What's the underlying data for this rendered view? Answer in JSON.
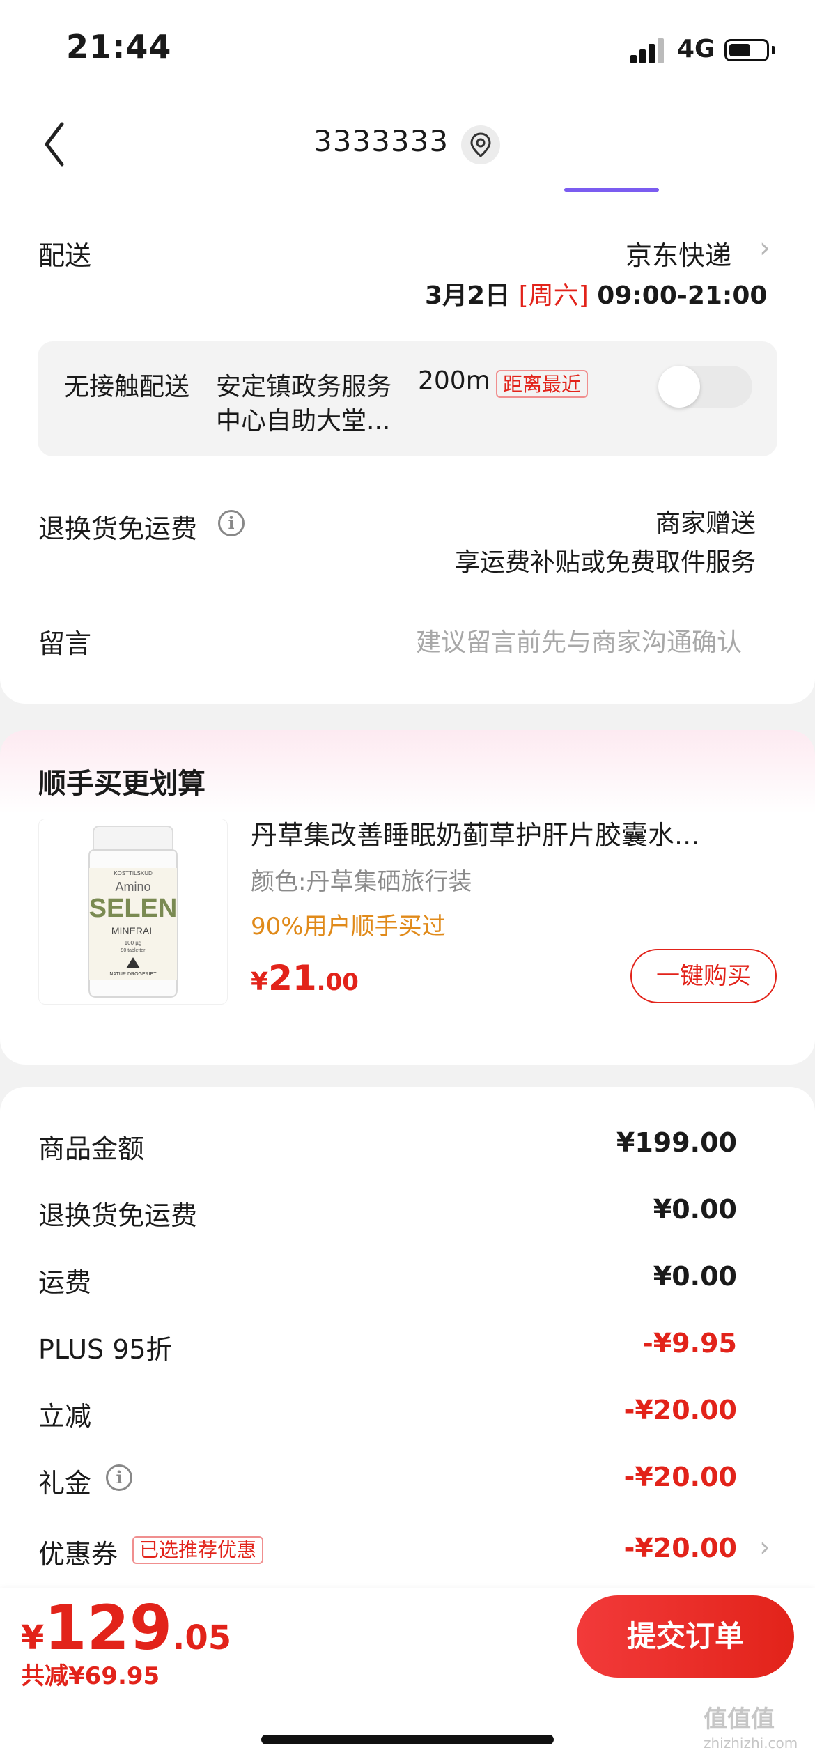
{
  "status_bar": {
    "time": "21:44",
    "network": "4G"
  },
  "header": {
    "title": "3333333"
  },
  "delivery": {
    "label": "配送",
    "carrier": "京东快递",
    "date": "3月2日",
    "weekday": "[周六]",
    "time_range": "09:00-21:00",
    "contactless_label": "无接触配送",
    "pickup_point_line1": "安定镇政务服务",
    "pickup_point_line2": "中心自助大堂...",
    "distance": "200m",
    "distance_badge": "距离最近"
  },
  "return_shipping": {
    "label": "退换货免运费",
    "value_line1": "商家赠送",
    "value_line2": "享运费补贴或免费取件服务"
  },
  "message": {
    "label": "留言",
    "placeholder": "建议留言前先与商家沟通确认"
  },
  "recommendation": {
    "title": "顺手买更划算",
    "product": {
      "name": "丹草集改善睡眠奶蓟草护肝片胶囊水...",
      "variant": "颜色:丹草集硒旅行装",
      "social_proof": "90%用户顺手买过",
      "price_symbol": "¥",
      "price_int": "21",
      "price_dec": ".00",
      "buy_label": "一键购买",
      "image_text": {
        "top": "KOSTTILSKUD",
        "brand_small": "Amino",
        "brand": "SELEN",
        "type": "MINERAL",
        "dose": "100 µg",
        "count": "90 tabletter",
        "maker": "NATUR DROGERIET"
      }
    }
  },
  "summary": {
    "rows": [
      {
        "label": "商品金额",
        "value": "¥199.00"
      },
      {
        "label": "退换货免运费",
        "value": "¥0.00"
      },
      {
        "label": "运费",
        "value": "¥0.00"
      },
      {
        "label": "PLUS 95折",
        "value": "-¥9.95"
      },
      {
        "label": "立减",
        "value": "-¥20.00"
      },
      {
        "label": "礼金",
        "value": "-¥20.00"
      },
      {
        "label": "优惠券",
        "value": "-¥20.00"
      }
    ],
    "coupon_badge": "已选推荐优惠"
  },
  "bottom_bar": {
    "currency": "¥",
    "total_int": "129",
    "total_dec": ".05",
    "total_discount": "共减¥69.95",
    "submit_label": "提交订单"
  },
  "watermark": {
    "text": "值值值",
    "url": "zhizhizhi.com"
  },
  "colors": {
    "accent_red": "#e2231a",
    "tab_indicator": "#7b5cf0",
    "social_orange": "#e08a1a"
  }
}
